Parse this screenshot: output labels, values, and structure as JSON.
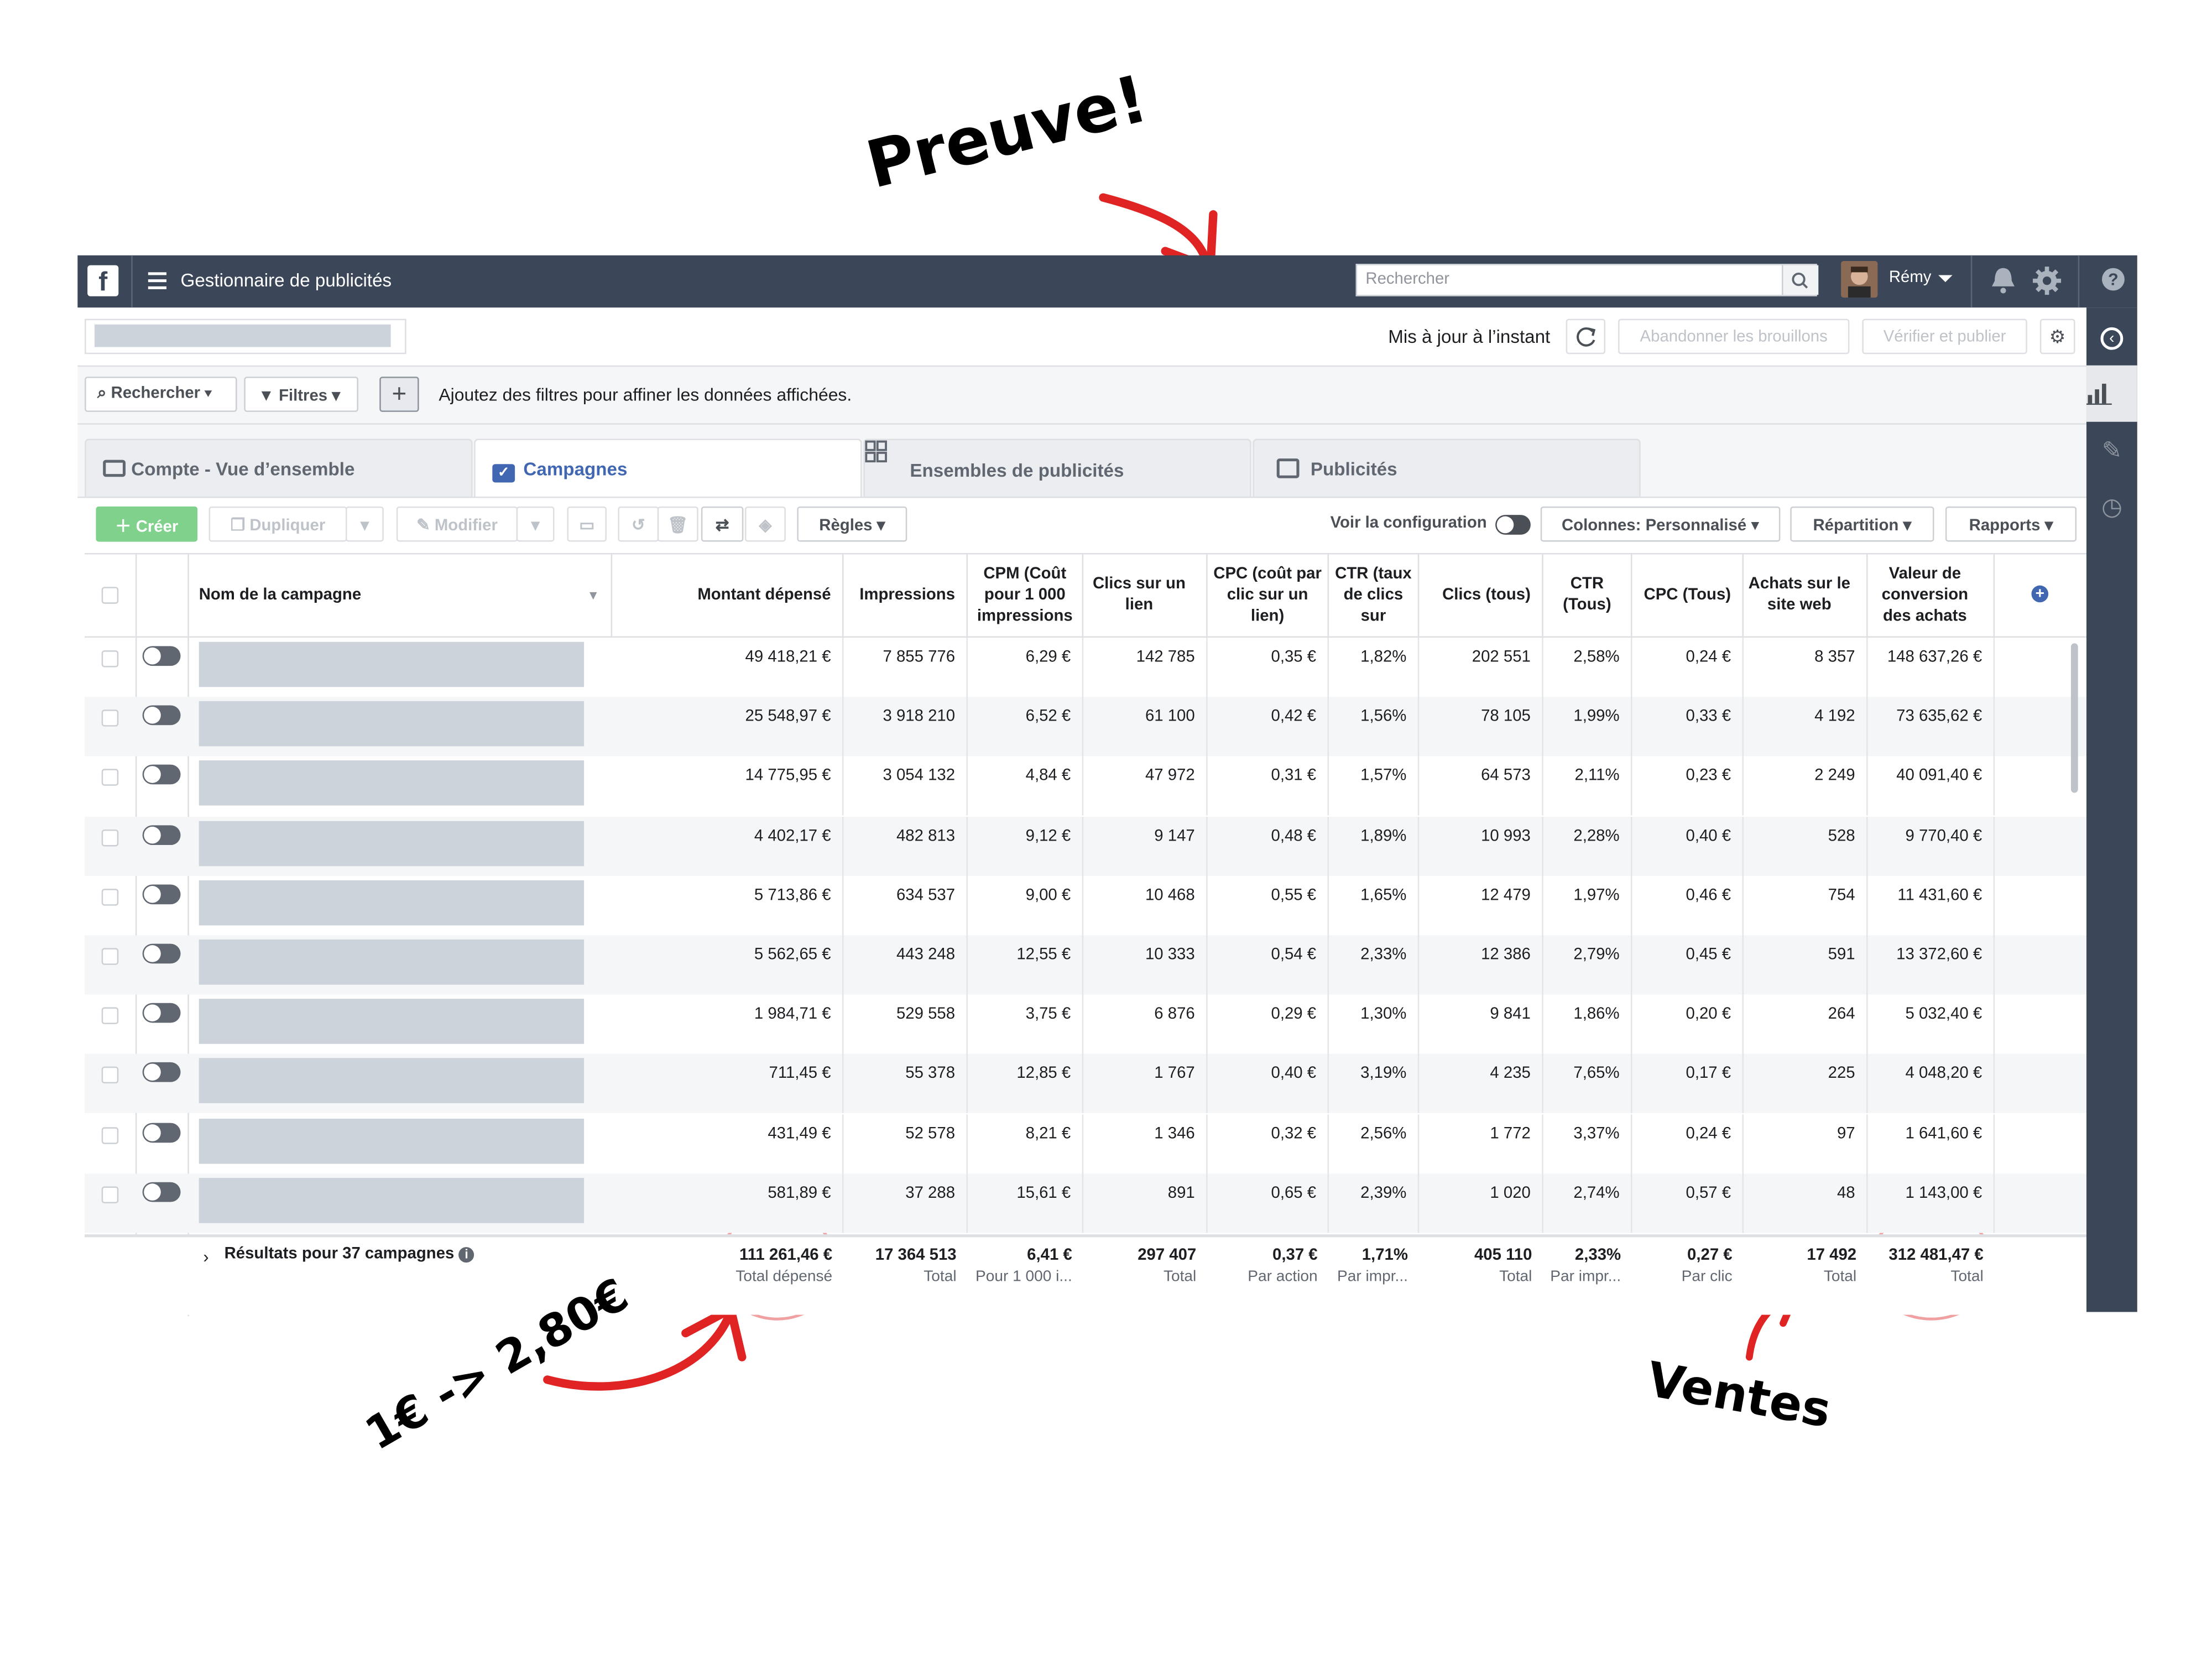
{
  "annotations": {
    "top": "Preuve!",
    "left": "1€ -> 2,80€",
    "right": "Ventes"
  },
  "topbar": {
    "logo": "f",
    "menu_icon": "hamburger-menu-icon",
    "title": "Gestionnaire de publicités",
    "search_placeholder": "Rechercher",
    "user_name": "Rémy",
    "icons": [
      "search-icon",
      "bell-icon",
      "gear-icon",
      "help-icon"
    ]
  },
  "header": {
    "status": "Mis à jour à l’instant",
    "discard_drafts": "Abandonner les brouillons",
    "review_publish": "Vérifier et publier"
  },
  "filterbar": {
    "search_label": "Rechercher",
    "filters_label": "Filtres",
    "add_filter": "+",
    "hint": "Ajoutez des filtres pour affiner les données affichées."
  },
  "tabs": [
    {
      "label": "Compte - Vue d’ensemble",
      "icon": "account-overview-icon"
    },
    {
      "label": "Campagnes",
      "icon": "campaigns-icon",
      "active": true
    },
    {
      "label": "Ensembles de publicités",
      "icon": "adsets-grid-icon"
    },
    {
      "label": "Publicités",
      "icon": "ads-icon"
    }
  ],
  "toolbar": {
    "create": "Créer",
    "duplicate": "Dupliquer",
    "edit": "Modifier",
    "rules": "Règles",
    "view_setup": "Voir la configuration",
    "columns_prefix": "Colonnes: ",
    "columns_value": "Personnalisé",
    "breakdown": "Répartition",
    "reports": "Rapports"
  },
  "table": {
    "columns": [
      "Nom de la campagne",
      "Montant dépensé",
      "Impressions",
      "CPM (Coût pour 1 000 impressions",
      "Clics sur un lien",
      "CPC (coût par clic sur un lien)",
      "CTR (taux de clics sur",
      "Clics (tous)",
      "CTR (Tous)",
      "CPC (Tous)",
      "Achats sur le site web",
      "Valeur de conversion des achats"
    ],
    "rows": [
      [
        "49 418,21 €",
        "7 855 776",
        "6,29 €",
        "142 785",
        "0,35 €",
        "1,82%",
        "202 551",
        "2,58%",
        "0,24 €",
        "8 357",
        "148 637,26 €"
      ],
      [
        "25 548,97 €",
        "3 918 210",
        "6,52 €",
        "61 100",
        "0,42 €",
        "1,56%",
        "78 105",
        "1,99%",
        "0,33 €",
        "4 192",
        "73 635,62 €"
      ],
      [
        "14 775,95 €",
        "3 054 132",
        "4,84 €",
        "47 972",
        "0,31 €",
        "1,57%",
        "64 573",
        "2,11%",
        "0,23 €",
        "2 249",
        "40 091,40 €"
      ],
      [
        "4 402,17 €",
        "482 813",
        "9,12 €",
        "9 147",
        "0,48 €",
        "1,89%",
        "10 993",
        "2,28%",
        "0,40 €",
        "528",
        "9 770,40 €"
      ],
      [
        "5 713,86 €",
        "634 537",
        "9,00 €",
        "10 468",
        "0,55 €",
        "1,65%",
        "12 479",
        "1,97%",
        "0,46 €",
        "754",
        "11 431,60 €"
      ],
      [
        "5 562,65 €",
        "443 248",
        "12,55 €",
        "10 333",
        "0,54 €",
        "2,33%",
        "12 386",
        "2,79%",
        "0,45 €",
        "591",
        "13 372,60 €"
      ],
      [
        "1 984,71 €",
        "529 558",
        "3,75 €",
        "6 876",
        "0,29 €",
        "1,30%",
        "9 841",
        "1,86%",
        "0,20 €",
        "264",
        "5 032,40 €"
      ],
      [
        "711,45 €",
        "55 378",
        "12,85 €",
        "1 767",
        "0,40 €",
        "3,19%",
        "4 235",
        "7,65%",
        "0,17 €",
        "225",
        "4 048,20 €"
      ],
      [
        "431,49 €",
        "52 578",
        "8,21 €",
        "1 346",
        "0,32 €",
        "2,56%",
        "1 772",
        "3,37%",
        "0,24 €",
        "97",
        "1 641,60 €"
      ],
      [
        "581,89 €",
        "37 288",
        "15,61 €",
        "891",
        "0,65 €",
        "2,39%",
        "1 020",
        "2,74%",
        "0,57 €",
        "48",
        "1 143,00 €"
      ]
    ],
    "totals_label": "Résultats pour 37 campagnes",
    "totals": [
      {
        "value": "111 261,46 €",
        "label": "Total dépensé"
      },
      {
        "value": "17 364 513",
        "label": "Total"
      },
      {
        "value": "6,41 €",
        "label": "Pour 1 000 i..."
      },
      {
        "value": "297 407",
        "label": "Total"
      },
      {
        "value": "0,37 €",
        "label": "Par action"
      },
      {
        "value": "1,71%",
        "label": "Par impr..."
      },
      {
        "value": "405 110",
        "label": "Total"
      },
      {
        "value": "2,33%",
        "label": "Par impr..."
      },
      {
        "value": "0,27 €",
        "label": "Par clic"
      },
      {
        "value": "17 492",
        "label": "Total"
      },
      {
        "value": "312 481,47 €",
        "label": "Total"
      }
    ]
  },
  "colors": {
    "topbar": "#3b4758",
    "accent": "#4267b2",
    "create_green": "#7fd18c",
    "annotation_red": "#e02424"
  }
}
